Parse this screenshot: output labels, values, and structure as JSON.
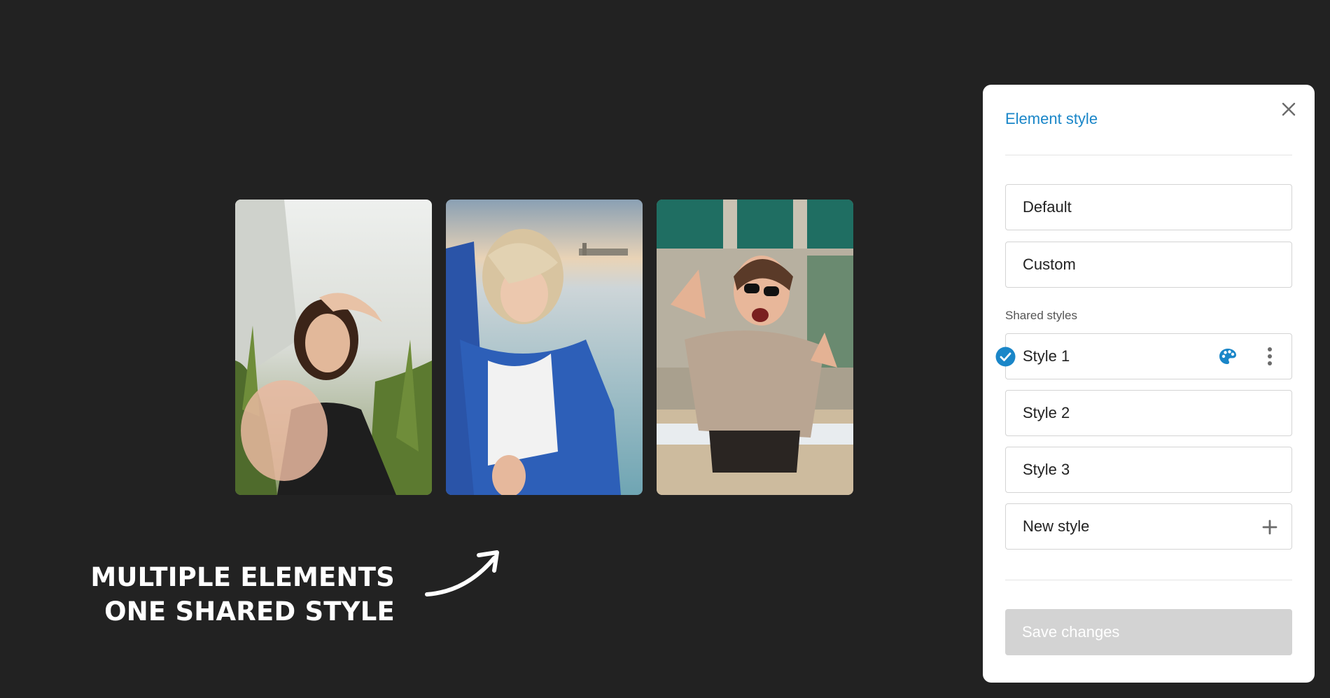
{
  "panel": {
    "title": "Element style",
    "options": {
      "default": "Default",
      "custom": "Custom"
    },
    "shared_styles_label": "Shared styles",
    "styles": [
      {
        "label": "Style 1",
        "selected": true
      },
      {
        "label": "Style 2",
        "selected": false
      },
      {
        "label": "Style 3",
        "selected": false
      }
    ],
    "new_style_label": "New style",
    "save_label": "Save changes",
    "icons": {
      "close": "close-icon",
      "check": "check-circle-icon",
      "palette": "palette-icon",
      "more": "kebab-menu-icon",
      "add": "plus-icon"
    },
    "colors": {
      "accent": "#1a86c8",
      "save_disabled_bg": "#d3d3d3"
    }
  },
  "caption": {
    "line1": "MULTIPLE ELEMENTS",
    "line2": "ONE SHARED STYLE"
  },
  "photos": [
    {
      "subject": "woman with hand raised in tall grass"
    },
    {
      "subject": "blonde woman with blue jacket by the water"
    },
    {
      "subject": "woman in sunglasses making peace signs"
    }
  ],
  "colors": {
    "background": "#222222"
  }
}
